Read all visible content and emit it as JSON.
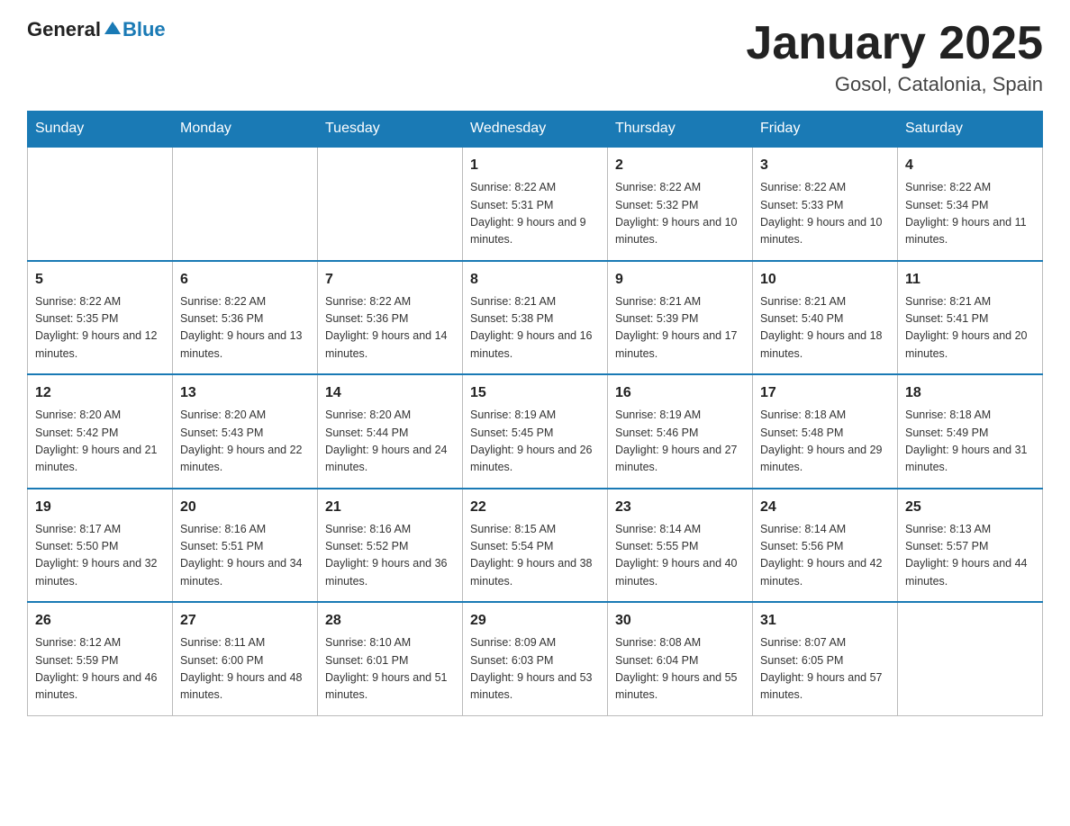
{
  "logo": {
    "general": "General",
    "blue": "Blue"
  },
  "title": "January 2025",
  "location": "Gosol, Catalonia, Spain",
  "days_of_week": [
    "Sunday",
    "Monday",
    "Tuesday",
    "Wednesday",
    "Thursday",
    "Friday",
    "Saturday"
  ],
  "weeks": [
    [
      {
        "day": "",
        "info": ""
      },
      {
        "day": "",
        "info": ""
      },
      {
        "day": "",
        "info": ""
      },
      {
        "day": "1",
        "info": "Sunrise: 8:22 AM\nSunset: 5:31 PM\nDaylight: 9 hours and 9 minutes."
      },
      {
        "day": "2",
        "info": "Sunrise: 8:22 AM\nSunset: 5:32 PM\nDaylight: 9 hours and 10 minutes."
      },
      {
        "day": "3",
        "info": "Sunrise: 8:22 AM\nSunset: 5:33 PM\nDaylight: 9 hours and 10 minutes."
      },
      {
        "day": "4",
        "info": "Sunrise: 8:22 AM\nSunset: 5:34 PM\nDaylight: 9 hours and 11 minutes."
      }
    ],
    [
      {
        "day": "5",
        "info": "Sunrise: 8:22 AM\nSunset: 5:35 PM\nDaylight: 9 hours and 12 minutes."
      },
      {
        "day": "6",
        "info": "Sunrise: 8:22 AM\nSunset: 5:36 PM\nDaylight: 9 hours and 13 minutes."
      },
      {
        "day": "7",
        "info": "Sunrise: 8:22 AM\nSunset: 5:36 PM\nDaylight: 9 hours and 14 minutes."
      },
      {
        "day": "8",
        "info": "Sunrise: 8:21 AM\nSunset: 5:38 PM\nDaylight: 9 hours and 16 minutes."
      },
      {
        "day": "9",
        "info": "Sunrise: 8:21 AM\nSunset: 5:39 PM\nDaylight: 9 hours and 17 minutes."
      },
      {
        "day": "10",
        "info": "Sunrise: 8:21 AM\nSunset: 5:40 PM\nDaylight: 9 hours and 18 minutes."
      },
      {
        "day": "11",
        "info": "Sunrise: 8:21 AM\nSunset: 5:41 PM\nDaylight: 9 hours and 20 minutes."
      }
    ],
    [
      {
        "day": "12",
        "info": "Sunrise: 8:20 AM\nSunset: 5:42 PM\nDaylight: 9 hours and 21 minutes."
      },
      {
        "day": "13",
        "info": "Sunrise: 8:20 AM\nSunset: 5:43 PM\nDaylight: 9 hours and 22 minutes."
      },
      {
        "day": "14",
        "info": "Sunrise: 8:20 AM\nSunset: 5:44 PM\nDaylight: 9 hours and 24 minutes."
      },
      {
        "day": "15",
        "info": "Sunrise: 8:19 AM\nSunset: 5:45 PM\nDaylight: 9 hours and 26 minutes."
      },
      {
        "day": "16",
        "info": "Sunrise: 8:19 AM\nSunset: 5:46 PM\nDaylight: 9 hours and 27 minutes."
      },
      {
        "day": "17",
        "info": "Sunrise: 8:18 AM\nSunset: 5:48 PM\nDaylight: 9 hours and 29 minutes."
      },
      {
        "day": "18",
        "info": "Sunrise: 8:18 AM\nSunset: 5:49 PM\nDaylight: 9 hours and 31 minutes."
      }
    ],
    [
      {
        "day": "19",
        "info": "Sunrise: 8:17 AM\nSunset: 5:50 PM\nDaylight: 9 hours and 32 minutes."
      },
      {
        "day": "20",
        "info": "Sunrise: 8:16 AM\nSunset: 5:51 PM\nDaylight: 9 hours and 34 minutes."
      },
      {
        "day": "21",
        "info": "Sunrise: 8:16 AM\nSunset: 5:52 PM\nDaylight: 9 hours and 36 minutes."
      },
      {
        "day": "22",
        "info": "Sunrise: 8:15 AM\nSunset: 5:54 PM\nDaylight: 9 hours and 38 minutes."
      },
      {
        "day": "23",
        "info": "Sunrise: 8:14 AM\nSunset: 5:55 PM\nDaylight: 9 hours and 40 minutes."
      },
      {
        "day": "24",
        "info": "Sunrise: 8:14 AM\nSunset: 5:56 PM\nDaylight: 9 hours and 42 minutes."
      },
      {
        "day": "25",
        "info": "Sunrise: 8:13 AM\nSunset: 5:57 PM\nDaylight: 9 hours and 44 minutes."
      }
    ],
    [
      {
        "day": "26",
        "info": "Sunrise: 8:12 AM\nSunset: 5:59 PM\nDaylight: 9 hours and 46 minutes."
      },
      {
        "day": "27",
        "info": "Sunrise: 8:11 AM\nSunset: 6:00 PM\nDaylight: 9 hours and 48 minutes."
      },
      {
        "day": "28",
        "info": "Sunrise: 8:10 AM\nSunset: 6:01 PM\nDaylight: 9 hours and 51 minutes."
      },
      {
        "day": "29",
        "info": "Sunrise: 8:09 AM\nSunset: 6:03 PM\nDaylight: 9 hours and 53 minutes."
      },
      {
        "day": "30",
        "info": "Sunrise: 8:08 AM\nSunset: 6:04 PM\nDaylight: 9 hours and 55 minutes."
      },
      {
        "day": "31",
        "info": "Sunrise: 8:07 AM\nSunset: 6:05 PM\nDaylight: 9 hours and 57 minutes."
      },
      {
        "day": "",
        "info": ""
      }
    ]
  ]
}
